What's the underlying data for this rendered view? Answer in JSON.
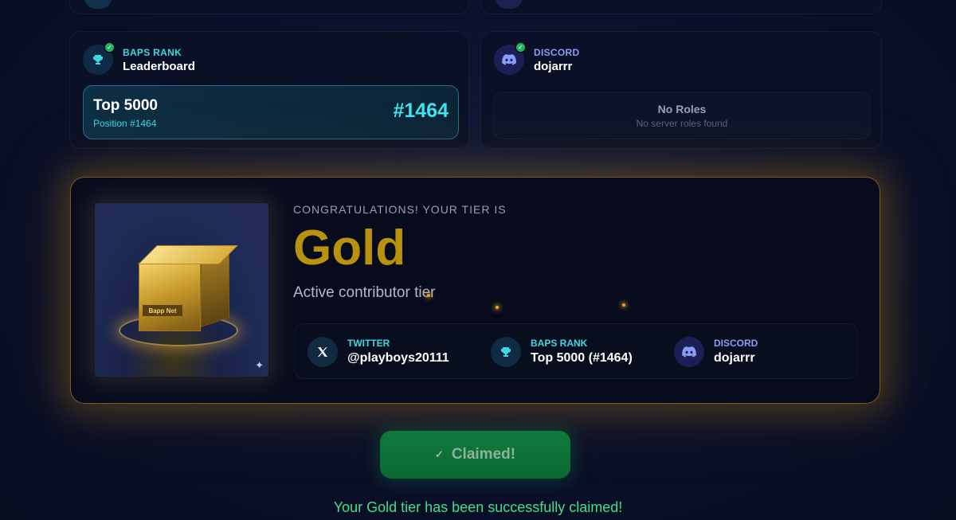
{
  "rank_card": {
    "label": "BAPS RANK",
    "value": "Leaderboard",
    "box_title": "Top 5000",
    "box_sub": "Position #1464",
    "box_num": "#1464",
    "icon": "trophy-icon"
  },
  "discord_card": {
    "label": "DISCORD",
    "value": "dojarrr",
    "roles_title": "No Roles",
    "roles_sub": "No server roles found",
    "icon": "discord-icon"
  },
  "tier": {
    "congrats": "CONGRATULATIONS! YOUR TIER IS",
    "name": "Gold",
    "description": "Active contributor tier",
    "chest_caption": "Bapp Net",
    "socials": [
      {
        "label": "TWITTER",
        "value": "@playboys20111",
        "icon": "x-logo-icon"
      },
      {
        "label": "BAPS RANK",
        "value": "Top 5000 (#1464)",
        "icon": "trophy-icon"
      },
      {
        "label": "DISCORD",
        "value": "dojarrr",
        "icon": "discord-icon"
      }
    ]
  },
  "claim": {
    "button_label": "Claimed!",
    "message": "Your Gold tier has been successfully claimed!"
  },
  "colors": {
    "gold": "#b8920f",
    "cyan": "#3fd6e0",
    "discord": "#8b9cf4",
    "success": "#3ee08a",
    "button": "#0f7a3a"
  }
}
